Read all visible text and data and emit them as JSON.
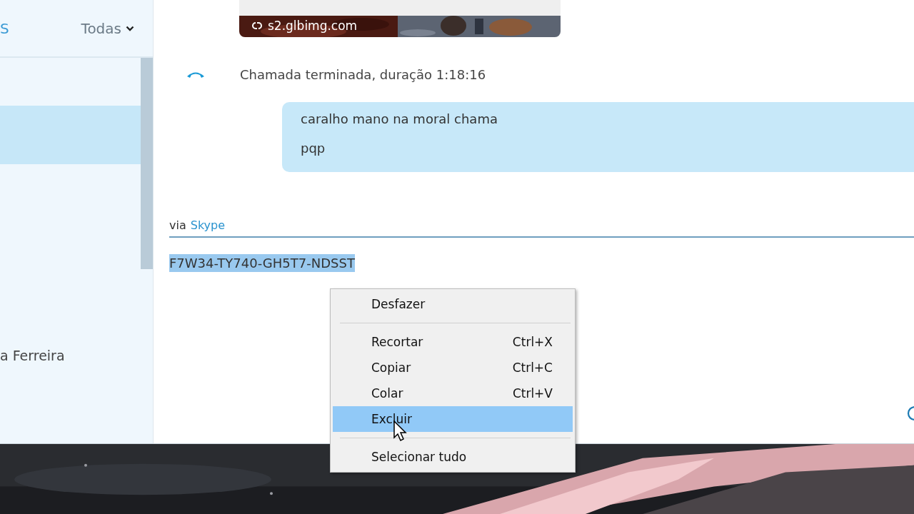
{
  "sidebar": {
    "header_text": "S",
    "filter": "Todas",
    "conversations": [
      {
        "selected": true
      },
      {
        "name": "a Ferreira",
        "selected": false
      }
    ]
  },
  "chat": {
    "link_preview": {
      "kind": "picture",
      "domain": "s2.glbimg.com"
    },
    "call_event": "Chamada terminada, duração 1:18:16",
    "bubble_lines": [
      "caralho mano na moral chama",
      "pqp"
    ],
    "via_label": "via",
    "via_link": "Skype",
    "input_value": "F7W34-TY740-GH5T7-NDSST"
  },
  "context_menu": [
    {
      "kind": "item",
      "label": "Desfazer",
      "selected": false
    },
    {
      "kind": "separator"
    },
    {
      "kind": "item",
      "label": "Recortar",
      "shortcut": "Ctrl+X",
      "selected": false
    },
    {
      "kind": "item",
      "label": "Copiar",
      "shortcut": "Ctrl+C",
      "selected": false
    },
    {
      "kind": "item",
      "label": "Colar",
      "shortcut": "Ctrl+V",
      "selected": false
    },
    {
      "kind": "item",
      "label": "Excluir",
      "selected": true
    },
    {
      "kind": "separator"
    },
    {
      "kind": "item",
      "label": "Selecionar tudo",
      "selected": false
    }
  ]
}
